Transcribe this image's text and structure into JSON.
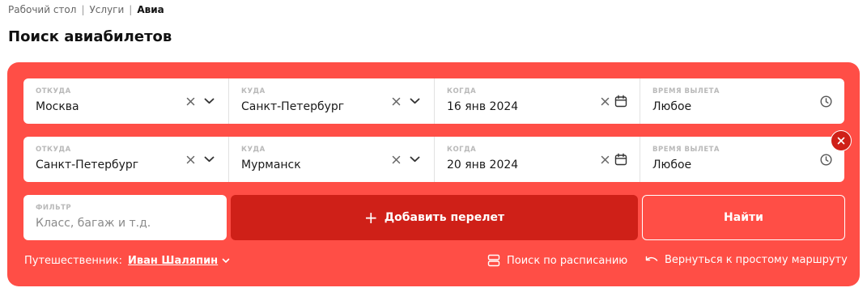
{
  "breadcrumb": {
    "items": [
      "Рабочий стол",
      "Услуги"
    ],
    "separator": "|",
    "current": "Авиа"
  },
  "page": {
    "title": "Поиск авиабилетов"
  },
  "colors": {
    "panel": "#ff4e46",
    "button_dark": "#cf2018",
    "field_bg": "#ffffff"
  },
  "icons": {
    "clear": "close-icon",
    "dropdown": "chevron-down-icon",
    "date": "calendar-icon",
    "time": "clock-icon",
    "remove": "remove-circle-icon",
    "schedule": "schedule-icon",
    "back": "undo-arrow-icon"
  },
  "routes": [
    {
      "from": {
        "label": "ОТКУДА",
        "value": "Москва"
      },
      "to": {
        "label": "КУДА",
        "value": "Санкт-Петербург"
      },
      "date": {
        "label": "КОГДА",
        "value": "16 янв 2024"
      },
      "time": {
        "label": "ВРЕМЯ ВЫЛЕТА",
        "value": "Любое"
      }
    },
    {
      "from": {
        "label": "ОТКУДА",
        "value": "Санкт-Петербург"
      },
      "to": {
        "label": "КУДА",
        "value": "Мурманск"
      },
      "date": {
        "label": "КОГДА",
        "value": "20 янв 2024"
      },
      "time": {
        "label": "ВРЕМЯ ВЫЛЕТА",
        "value": "Любое"
      }
    }
  ],
  "filter": {
    "label": "ФИЛЬТР",
    "placeholder": "Класс, багаж и т.д."
  },
  "actions": {
    "add_flight": "Добавить перелет",
    "add_icon": "+",
    "search": "Найти"
  },
  "footer": {
    "traveler_label": "Путешественник:",
    "traveler_name": "Иван Шаляпин",
    "schedule_search": "Поиск по расписанию",
    "back_to_simple": "Вернуться к простому маршруту"
  }
}
